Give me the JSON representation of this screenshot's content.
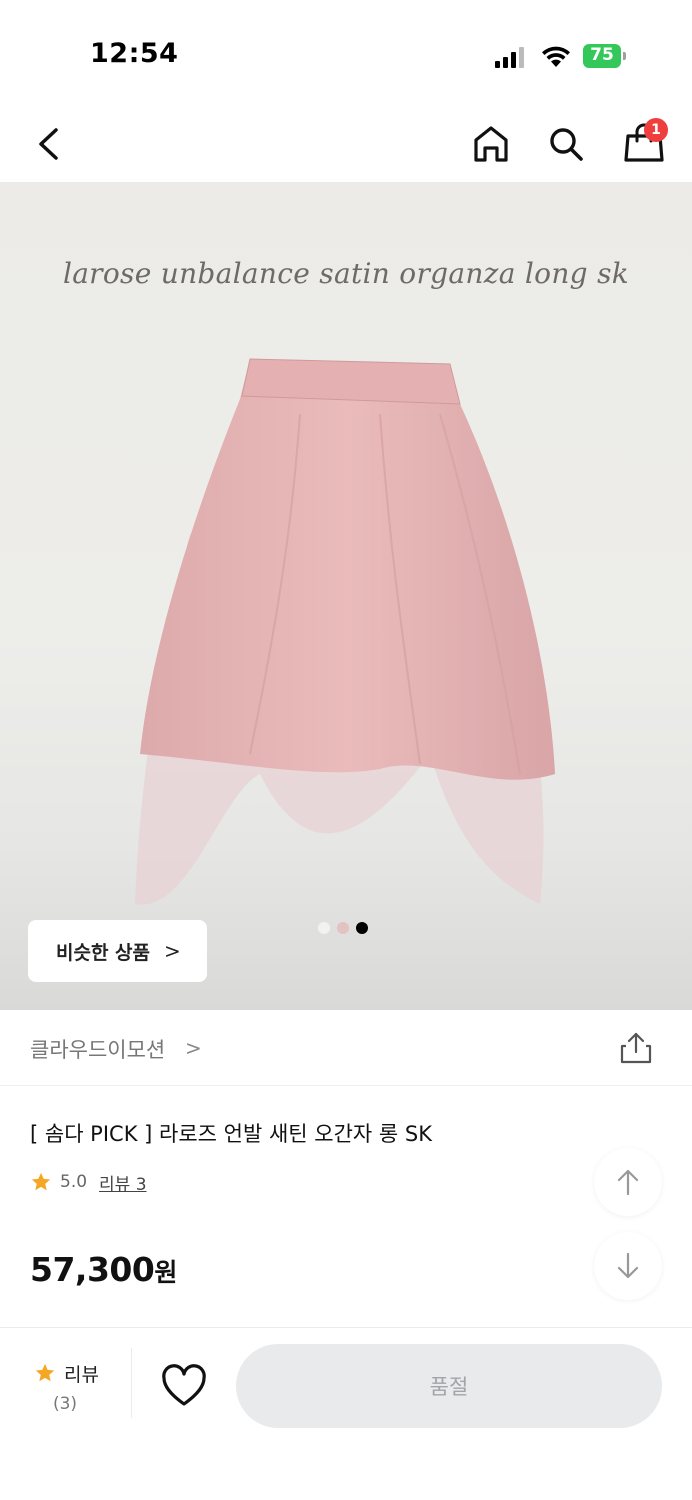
{
  "status_bar": {
    "time": "12:54",
    "battery": "75"
  },
  "nav": {
    "cart_count": "1"
  },
  "hero": {
    "caption": "larose unbalance satin organza long sk",
    "similar_label": "비슷한 상품",
    "similar_chevron": ">",
    "carousel": {
      "total": 3,
      "active": 3
    }
  },
  "brand": {
    "name": "클라우드이모션",
    "chevron": ">"
  },
  "product": {
    "name": "[ 솜다 PICK ] 라로즈 언발 새틴 오간자 롱 SK",
    "rating": "5.0",
    "review_link": "리뷰 3",
    "price": "57,300",
    "price_unit": "원"
  },
  "bottom_bar": {
    "review_label": "리뷰",
    "review_count": "(3)",
    "soldout_label": "품절"
  },
  "colors": {
    "accent_star": "#f5a623",
    "badge": "#ef3e3e",
    "battery": "#34c759",
    "skirt": "#e6b3b4"
  }
}
